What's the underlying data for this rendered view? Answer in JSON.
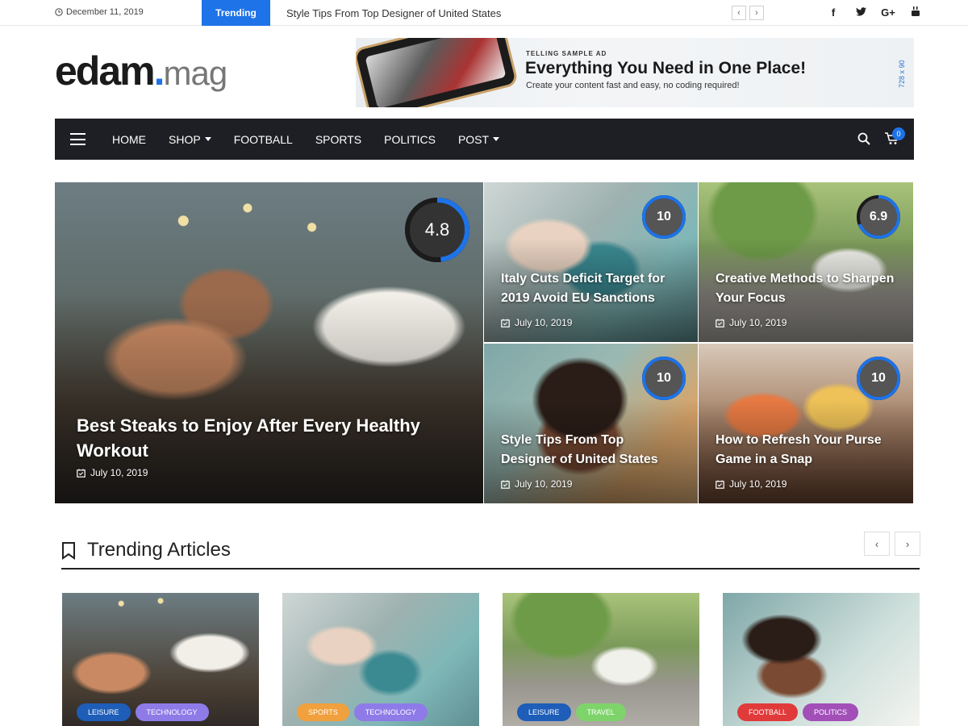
{
  "topbar": {
    "date": "December 11, 2019",
    "trending_label": "Trending",
    "headline": "Style Tips From Top Designer of United States",
    "prev_arrow": "‹",
    "next_arrow": "›",
    "social": [
      {
        "name": "facebook-icon",
        "glyph": "f"
      },
      {
        "name": "twitter-icon",
        "glyph": "🐦"
      },
      {
        "name": "google-plus-icon",
        "glyph": "G+"
      },
      {
        "name": "youtube-icon",
        "glyph": "▶"
      }
    ]
  },
  "logo": {
    "main": "edam",
    "dot": ".",
    "sub": "mag"
  },
  "ad": {
    "kicker": "TELLING SAMPLE AD",
    "title": "Everything You Need in One Place!",
    "subtitle": "Create your content fast and easy, no coding required!",
    "size_label": "728 x 90"
  },
  "nav": {
    "items": [
      {
        "label": "HOME",
        "dropdown": false
      },
      {
        "label": "SHOP",
        "dropdown": true
      },
      {
        "label": "FOOTBALL",
        "dropdown": false
      },
      {
        "label": "SPORTS",
        "dropdown": false
      },
      {
        "label": "POLITICS",
        "dropdown": false
      },
      {
        "label": "POST",
        "dropdown": true
      }
    ],
    "cart_count": "0"
  },
  "hero": {
    "main": {
      "title": "Best Steaks to Enjoy After Every Healthy Workout",
      "date": "July 10, 2019",
      "score": "4.8",
      "score_fraction": 0.48
    },
    "a": {
      "title": "Italy Cuts Deficit Target for 2019 Avoid EU Sanctions",
      "date": "July 10, 2019",
      "score": "10",
      "score_fraction": 1.0
    },
    "b": {
      "title": "Creative Methods to Sharpen Your Focus",
      "date": "July 10, 2019",
      "score": "6.9",
      "score_fraction": 0.69
    },
    "c": {
      "title": "Style Tips From Top Designer of United States",
      "date": "July 10, 2019",
      "score": "10",
      "score_fraction": 1.0
    },
    "d": {
      "title": "How to Refresh Your Purse Game in a Snap",
      "date": "July 10, 2019",
      "score": "10",
      "score_fraction": 1.0
    }
  },
  "trending": {
    "title": "Trending Articles",
    "prev_arrow": "‹",
    "next_arrow": "›",
    "cards": [
      {
        "tags": [
          {
            "label": "LEISURE",
            "color": "#1e5db8"
          },
          {
            "label": "TECHNOLOGY",
            "color": "#8e7be8"
          }
        ]
      },
      {
        "tags": [
          {
            "label": "SPORTS",
            "color": "#f0a03c"
          },
          {
            "label": "TECHNOLOGY",
            "color": "#8e7be8"
          }
        ]
      },
      {
        "tags": [
          {
            "label": "LEISURE",
            "color": "#1e5db8"
          },
          {
            "label": "TRAVEL",
            "color": "#7ed46a"
          }
        ]
      },
      {
        "tags": [
          {
            "label": "FOOTBALL",
            "color": "#e13a3a"
          },
          {
            "label": "POLITICS",
            "color": "#a24fb8"
          }
        ]
      }
    ]
  },
  "colors": {
    "accent": "#1e73e8",
    "nav_bg": "#1e1f24"
  }
}
